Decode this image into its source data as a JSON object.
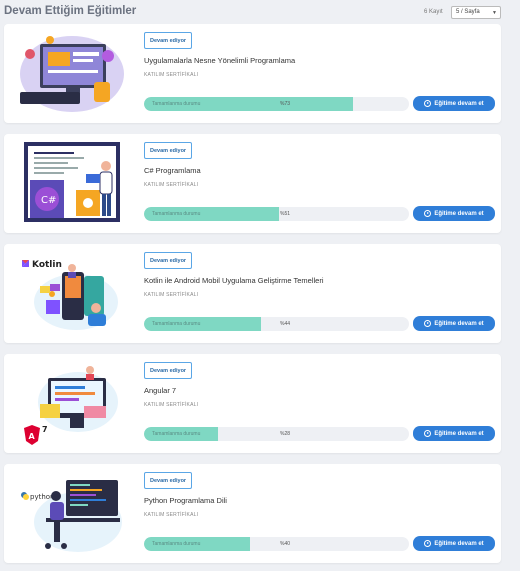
{
  "header": {
    "title": "Devam Ettiğim Eğitimler",
    "record_count": "6 Kayıt",
    "per_page": "5 / Sayfa"
  },
  "common": {
    "status_badge": "Devam ediyor",
    "certificate_label": "KATILIM SERTİFİKALI",
    "progress_label": "Tamamlanma durumu",
    "continue_label": "Eğitime devam et"
  },
  "courses": [
    {
      "title": "Uygulamalarla Nesne Yönelimli Programlama",
      "progress_text": "%73",
      "progress": 0.79,
      "illustration": "desktop-developer-illustration"
    },
    {
      "title": "C# Programlama",
      "progress_text": "%51",
      "progress": 0.51,
      "illustration": "csharp-illustration"
    },
    {
      "title": "Kotlin ile Android Mobil Uygulama Geliştirme Temelleri",
      "progress_text": "%44",
      "progress": 0.44,
      "illustration": "kotlin-illustration",
      "brand": "Kotlin"
    },
    {
      "title": "Angular 7",
      "progress_text": "%28",
      "progress": 0.28,
      "illustration": "angular-illustration",
      "brand": "7"
    },
    {
      "title": "Python Programlama Dili",
      "progress_text": "%40",
      "progress": 0.4,
      "illustration": "python-illustration",
      "brand": "python"
    }
  ],
  "colors": {
    "accent_button": "#2f7ed8",
    "progress_fill": "#7fd8c3",
    "badge_border": "#5aa6e6"
  }
}
